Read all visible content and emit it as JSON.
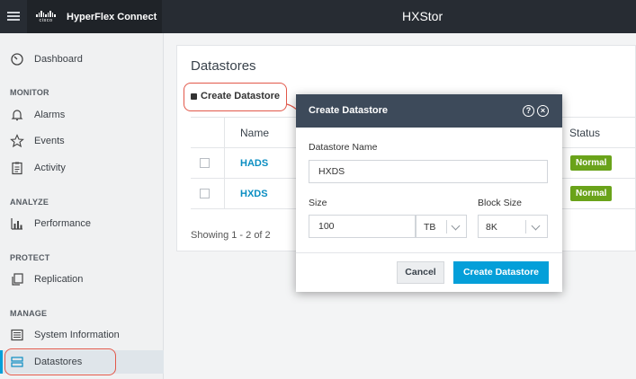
{
  "topbar": {
    "brand_logo_text": "cisco",
    "app_name": "HyperFlex Connect",
    "cluster_name": "HXStor"
  },
  "sidebar": {
    "dashboard": "Dashboard",
    "sections": {
      "monitor": "MONITOR",
      "analyze": "ANALYZE",
      "protect": "PROTECT",
      "manage": "MANAGE"
    },
    "items": {
      "alarms": "Alarms",
      "events": "Events",
      "activity": "Activity",
      "performance": "Performance",
      "replication": "Replication",
      "system_information": "System Information",
      "datastores": "Datastores"
    },
    "active": "Datastores"
  },
  "page": {
    "title": "Datastores",
    "create_link": "Create Datastore",
    "table": {
      "columns": {
        "name": "Name",
        "status": "Status"
      },
      "rows": [
        {
          "name": "HADS",
          "status": "Normal"
        },
        {
          "name": "HXDS",
          "status": "Normal"
        }
      ]
    },
    "showing": "Showing 1 - 2 of 2"
  },
  "modal": {
    "title": "Create Datastore",
    "help_glyph": "?",
    "close_glyph": "×",
    "name_label": "Datastore Name",
    "name_value": "HXDS",
    "size_label": "Size",
    "size_value": "100",
    "size_unit": "TB",
    "block_size_label": "Block Size",
    "block_size_value": "8K",
    "cancel_label": "Cancel",
    "create_label": "Create Datastore"
  },
  "colors": {
    "topbar": "#272c33",
    "modal_header": "#3d4a5a",
    "primary_button": "#049fd9",
    "status_normal": "#6aa31a",
    "link": "#0b8ec2",
    "highlight_circle": "#e2584a"
  }
}
